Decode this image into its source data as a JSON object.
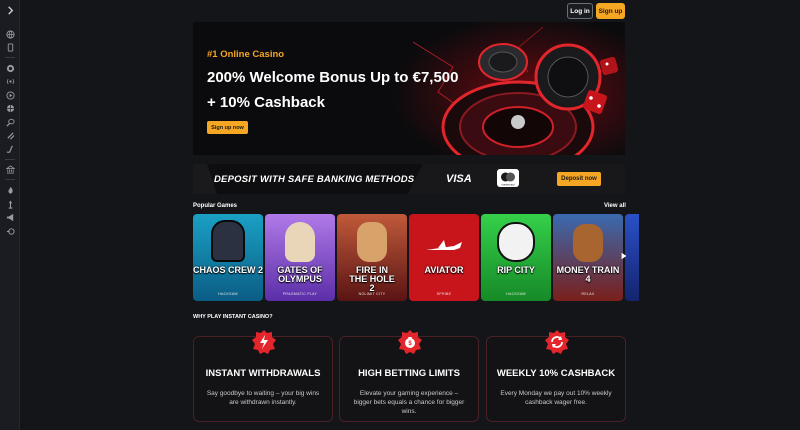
{
  "header": {
    "login_label": "Log in",
    "signup_label": "Sign up"
  },
  "sidebar": {
    "icons": [
      "chevron-right-icon",
      "globe-icon",
      "mobile-icon",
      "casino-chip-icon",
      "live-icon",
      "play-icon",
      "sport-ball-icon",
      "tennis-icon",
      "esports-icon",
      "hockey-icon",
      "bank-icon",
      "fire-icon",
      "joker-icon",
      "megaphone-icon",
      "vip-icon"
    ]
  },
  "hero": {
    "kicker": "#1 Online Casino",
    "title_line1": "200% Welcome Bonus Up to €7,500",
    "title_line2": "+ 10% Cashback",
    "cta_label": "Sign up now"
  },
  "banking": {
    "text": "DEPOSIT WITH SAFE BANKING METHODS",
    "visa_label": "VISA",
    "mastercard_label": "mastercard",
    "cta_label": "Deposit now"
  },
  "popular": {
    "title": "Popular Games",
    "view_all": "View all",
    "games": [
      {
        "title": "CHAOS CREW 2",
        "provider": "HACKSAW",
        "color": "#22a5c9"
      },
      {
        "title": "GATES OF OLYMPUS",
        "provider": "PRAGMATIC PLAY",
        "color": "#8a4fd6"
      },
      {
        "title": "FIRE IN THE HOLE 2",
        "provider": "NOLIMIT CITY",
        "color": "#9c2a2a"
      },
      {
        "title": "AVIATOR",
        "provider": "SPRIBE",
        "color": "#c8151c"
      },
      {
        "title": "RIP CITY",
        "provider": "HACKSAW",
        "color": "#28b23b"
      },
      {
        "title": "MONEY TRAIN 4",
        "provider": "RELAX",
        "color": "#a8261d"
      },
      {
        "title": "",
        "provider": "",
        "color": "#1d3a9c"
      }
    ]
  },
  "why": {
    "title": "WHY PLAY INSTANT CASINO?",
    "cards": [
      {
        "title": "INSTANT WITHDRAWALS",
        "line1": "Say goodbye to waiting – your big wins",
        "line2": "are withdrawn instantly.",
        "line3": "",
        "icon": "lightning-icon"
      },
      {
        "title": "HIGH BETTING LIMITS",
        "line1": "Elevate your gaming experience –",
        "line2": "bigger bets equals a chance for bigger",
        "line3": "wins.",
        "icon": "money-bag-icon"
      },
      {
        "title": "WEEKLY 10% CASHBACK",
        "line1": "Every Monday we pay out 10% weekly",
        "line2": "cashback wager free.",
        "line3": "",
        "icon": "refresh-icon"
      }
    ]
  },
  "colors": {
    "accent": "#f5a623",
    "brand_red": "#e3262c",
    "background": "#141519"
  }
}
